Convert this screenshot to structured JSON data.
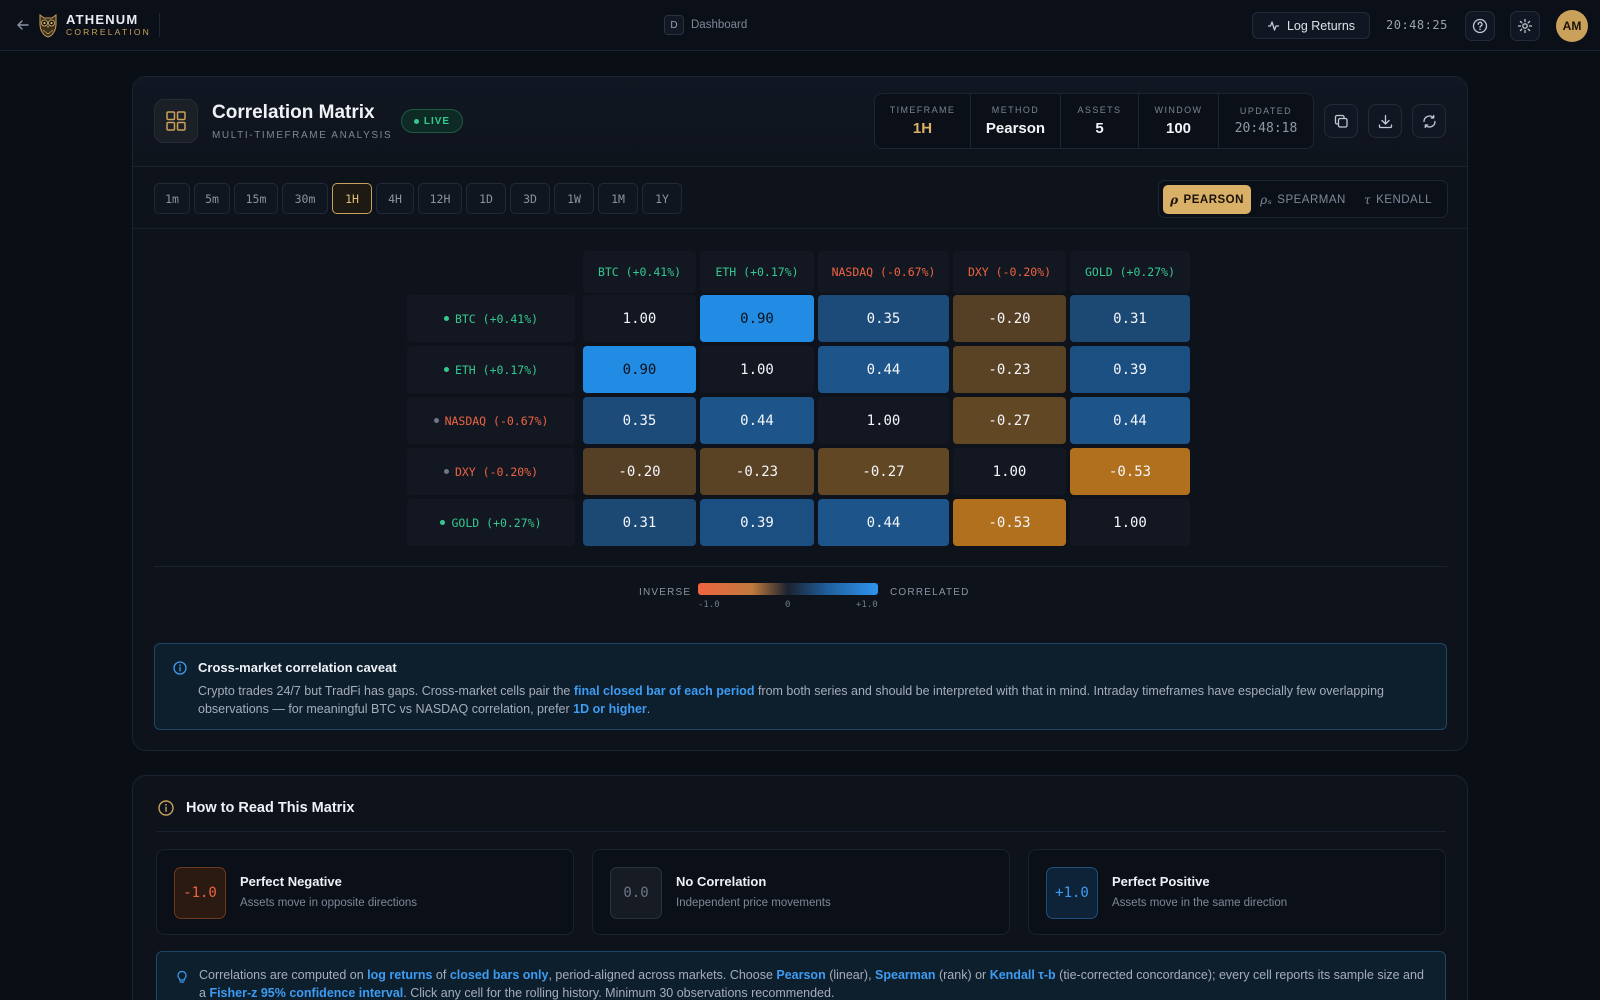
{
  "topbar": {
    "brand_name": "ATHENUM",
    "brand_sub": "CORRELATION",
    "breadcrumb_key": "D",
    "breadcrumb_label": "Dashboard",
    "log_returns_label": "Log Returns",
    "clock": "20:48:25",
    "avatar_initials": "AM"
  },
  "header": {
    "title": "Correlation Matrix",
    "subtitle": "MULTI-TIMEFRAME ANALYSIS",
    "live_label": "LIVE",
    "stats": [
      {
        "label": "TIMEFRAME",
        "value": "1H"
      },
      {
        "label": "METHOD",
        "value": "Pearson"
      },
      {
        "label": "ASSETS",
        "value": "5"
      },
      {
        "label": "WINDOW",
        "value": "100"
      },
      {
        "label": "UPDATED",
        "value": "20:48:18"
      }
    ]
  },
  "timeframes": [
    "1m",
    "5m",
    "15m",
    "30m",
    "1H",
    "4H",
    "12H",
    "1D",
    "3D",
    "1W",
    "1M",
    "1Y"
  ],
  "active_timeframe": "1H",
  "methods": [
    {
      "symbol": "ρ",
      "label": "PEARSON",
      "active": true
    },
    {
      "symbol": "ρₛ",
      "label": "SPEARMAN",
      "active": false
    },
    {
      "symbol": "τ",
      "label": "KENDALL",
      "active": false
    }
  ],
  "assets": [
    {
      "label": "BTC (+0.41%)",
      "trend": "pos"
    },
    {
      "label": "ETH (+0.17%)",
      "trend": "pos"
    },
    {
      "label": "NASDAQ (-0.67%)",
      "trend": "neg"
    },
    {
      "label": "DXY (-0.20%)",
      "trend": "neg"
    },
    {
      "label": "GOLD (+0.27%)",
      "trend": "pos"
    }
  ],
  "matrix": [
    [
      1.0,
      0.9,
      0.35,
      -0.2,
      0.31
    ],
    [
      0.9,
      1.0,
      0.44,
      -0.23,
      0.39
    ],
    [
      0.35,
      0.44,
      1.0,
      -0.27,
      0.44
    ],
    [
      -0.2,
      -0.23,
      -0.27,
      1.0,
      -0.53
    ],
    [
      0.31,
      0.39,
      0.44,
      -0.53,
      1.0
    ]
  ],
  "legend": {
    "left": "INVERSE",
    "right": "CORRELATED",
    "min": "-1.0",
    "mid": "0",
    "max": "+1.0"
  },
  "caveat": {
    "title": "Cross-market correlation caveat",
    "t1": "Crypto trades 24/7 but TradFi has gaps. Cross-market cells pair the ",
    "h1": "final closed bar of each period",
    "t2": " from both series and should be interpreted with that in mind. Intraday timeframes have especially few overlapping observations — for meaningful BTC vs NASDAQ correlation, prefer ",
    "h2": "1D or higher",
    "t3": "."
  },
  "howto": {
    "title": "How to Read This Matrix",
    "items": [
      {
        "badge": "-1.0",
        "title": "Perfect Negative",
        "desc": "Assets move in opposite directions"
      },
      {
        "badge": "0.0",
        "title": "No Correlation",
        "desc": "Independent price movements"
      },
      {
        "badge": "+1.0",
        "title": "Perfect Positive",
        "desc": "Assets move in the same direction"
      }
    ],
    "note": {
      "t1": "Correlations are computed on ",
      "h1": "log returns",
      "t2": " of ",
      "h2": "closed bars only",
      "t3": ", period-aligned across markets. Choose ",
      "h3": "Pearson",
      "t4": " (linear), ",
      "h4": "Spearman",
      "t5": " (rank) or ",
      "h5": "Kendall τ-b",
      "t6": " (tie-corrected concordance); every cell reports its sample size and a ",
      "h6": "Fisher-z 95% confidence interval",
      "t7": ". Click any cell for the rolling history. Minimum 30 observations recommended."
    }
  },
  "colors": {
    "accent_gold": "#d9b068",
    "positive": "#35c98f",
    "negative": "#ef6440",
    "correlated_blue": "#2e94ee",
    "inverse_orange": "#c07a3c"
  }
}
